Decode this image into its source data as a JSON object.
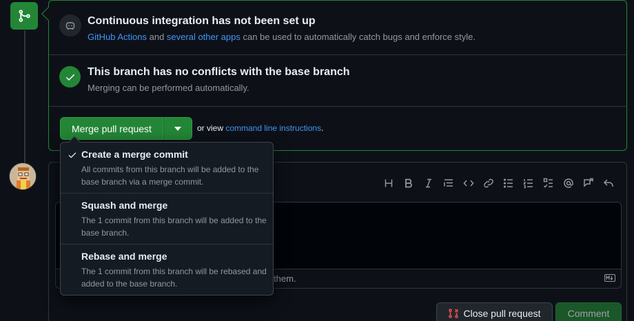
{
  "merge_box": {
    "ci": {
      "title": "Continuous integration has not been set up",
      "link1": "GitHub Actions",
      "middle": " and ",
      "link2": "several other apps",
      "rest": " can be used to automatically catch bugs and enforce style."
    },
    "conflicts": {
      "title": "This branch has no conflicts with the base branch",
      "desc": "Merging can be performed automatically."
    },
    "actions": {
      "merge_label": "Merge pull request",
      "or_view": "or view ",
      "cli_link": "command line instructions",
      "period": "."
    }
  },
  "dropdown": {
    "items": [
      {
        "title": "Create a merge commit",
        "desc": "All commits from this branch will be added to the base branch via a merge commit.",
        "selected": true
      },
      {
        "title": "Squash and merge",
        "desc": "The 1 commit from this branch will be added to the base branch.",
        "selected": false
      },
      {
        "title": "Rebase and merge",
        "desc": "The 1 commit from this branch will be rebased and added to the base branch.",
        "selected": false
      }
    ]
  },
  "comment": {
    "footer_text": "ng them.",
    "toolbar_icons": [
      "heading-icon",
      "bold-icon",
      "italic-icon",
      "quote-icon",
      "code-icon",
      "link-icon",
      "unordered-list-icon",
      "ordered-list-icon",
      "task-list-icon",
      "mention-icon",
      "cross-reference-icon",
      "reply-icon"
    ],
    "close_label": "Close pull request",
    "comment_label": "Comment"
  },
  "colors": {
    "accent_green": "#238636",
    "link_blue": "#4493f8",
    "close_icon_red": "#f85149"
  }
}
